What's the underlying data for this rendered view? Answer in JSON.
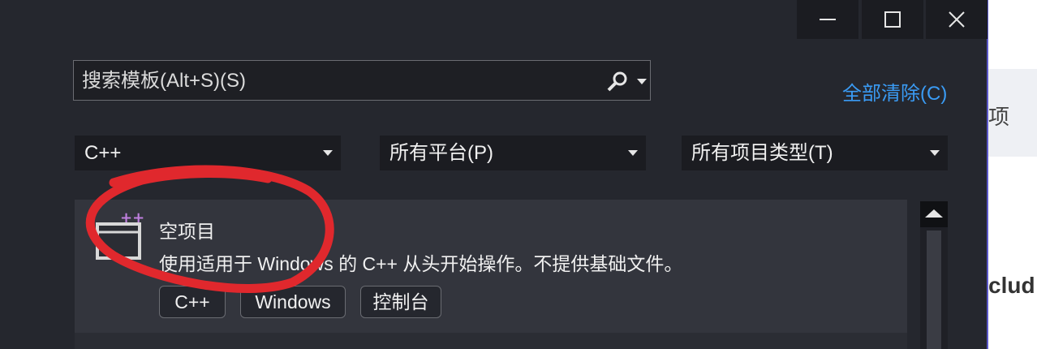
{
  "window_controls": {
    "minimize_icon": "minimize-icon",
    "maximize_icon": "maximize-icon",
    "close_icon": "close-icon"
  },
  "search": {
    "placeholder": "搜索模板(Alt+S)(S)",
    "value": ""
  },
  "clear_all": "全部清除(C)",
  "filters": {
    "language": "C++",
    "platform": "所有平台(P)",
    "project_type": "所有项目类型(T)"
  },
  "template_item": {
    "title": "空项目",
    "description": "使用适用于 Windows 的 C++ 从头开始操作。不提供基础文件。",
    "tags": [
      "C++",
      "Windows",
      "控制台"
    ]
  },
  "background": {
    "partial_label": "项",
    "partial_code": "clud"
  },
  "colors": {
    "dialog_bg": "#25272e",
    "accent_link": "#3a9bf4",
    "annotation": "#e0282d",
    "icon_plus": "#c080e0"
  }
}
